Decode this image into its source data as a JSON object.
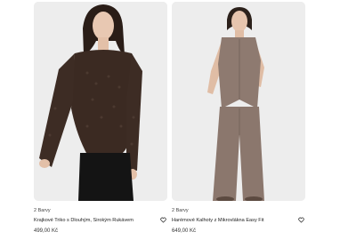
{
  "products": [
    {
      "colors": "2 Barvy",
      "title": "Krajkové Triko s Dlouhým, Širokým Rukávem",
      "price": "499,00 Kč",
      "image_icon": "lace-top-photo",
      "favorite_icon": "heart-outline-icon"
    },
    {
      "colors": "2 Barvy",
      "title": "Harémové Kalhoty z Mikrovlákna Easy Fit",
      "price": "649,00 Kč",
      "image_icon": "pants-outfit-photo",
      "favorite_icon": "heart-outline-icon"
    }
  ],
  "palette": {
    "background": "#ffffff",
    "image_bg": "#ececec",
    "top_brown": "#3b2a22",
    "outfit_taupe": "#8e7a70",
    "text": "#222222"
  }
}
